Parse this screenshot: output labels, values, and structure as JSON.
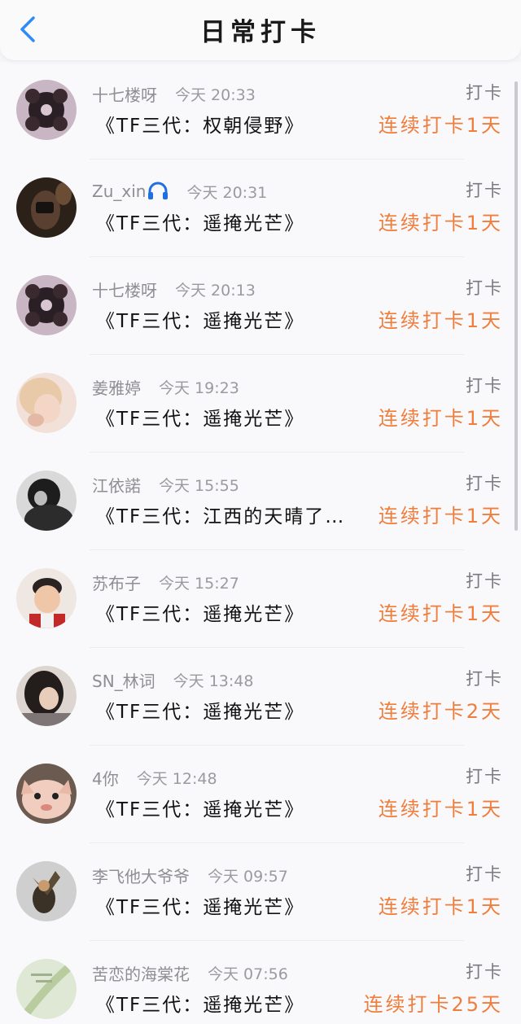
{
  "header": {
    "title": "日常打卡",
    "back_icon": "chevron-left-icon"
  },
  "colors": {
    "accent": "#2f8cf7",
    "streak": "#ef7e3c"
  },
  "checkins": [
    {
      "user": "十七楼呀",
      "time": "今天 20:33",
      "topic": "《TF三代：权朝侵野》",
      "action": "打卡",
      "streak": "连续打卡1天"
    },
    {
      "user": "Zu_xin",
      "user_icon": "headphones-icon",
      "time": "今天 20:31",
      "topic": "《TF三代：遥掩光芒》",
      "action": "打卡",
      "streak": "连续打卡1天"
    },
    {
      "user": "十七楼呀",
      "time": "今天 20:13",
      "topic": "《TF三代：遥掩光芒》",
      "action": "打卡",
      "streak": "连续打卡1天"
    },
    {
      "user": "姜雅婷",
      "time": "今天 19:23",
      "topic": "《TF三代：遥掩光芒》",
      "action": "打卡",
      "streak": "连续打卡1天"
    },
    {
      "user": "江依諾",
      "time": "今天 15:55",
      "topic": "《TF三代：江西的天晴了…",
      "action": "打卡",
      "streak": "连续打卡1天"
    },
    {
      "user": "苏布子",
      "time": "今天 15:27",
      "topic": "《TF三代：遥掩光芒》",
      "action": "打卡",
      "streak": "连续打卡1天"
    },
    {
      "user": "SN_林词",
      "time": "今天 13:48",
      "topic": "《TF三代：遥掩光芒》",
      "action": "打卡",
      "streak": "连续打卡2天"
    },
    {
      "user": "4你",
      "time": "今天 12:48",
      "topic": "《TF三代：遥掩光芒》",
      "action": "打卡",
      "streak": "连续打卡1天"
    },
    {
      "user": "李飞他大爷爷",
      "time": "今天 09:57",
      "topic": "《TF三代：遥掩光芒》",
      "action": "打卡",
      "streak": "连续打卡1天"
    },
    {
      "user": "苦恋的海棠花",
      "time": "今天 07:56",
      "topic": "《TF三代：遥掩光芒》",
      "action": "打卡",
      "streak": "连续打卡25天"
    }
  ]
}
